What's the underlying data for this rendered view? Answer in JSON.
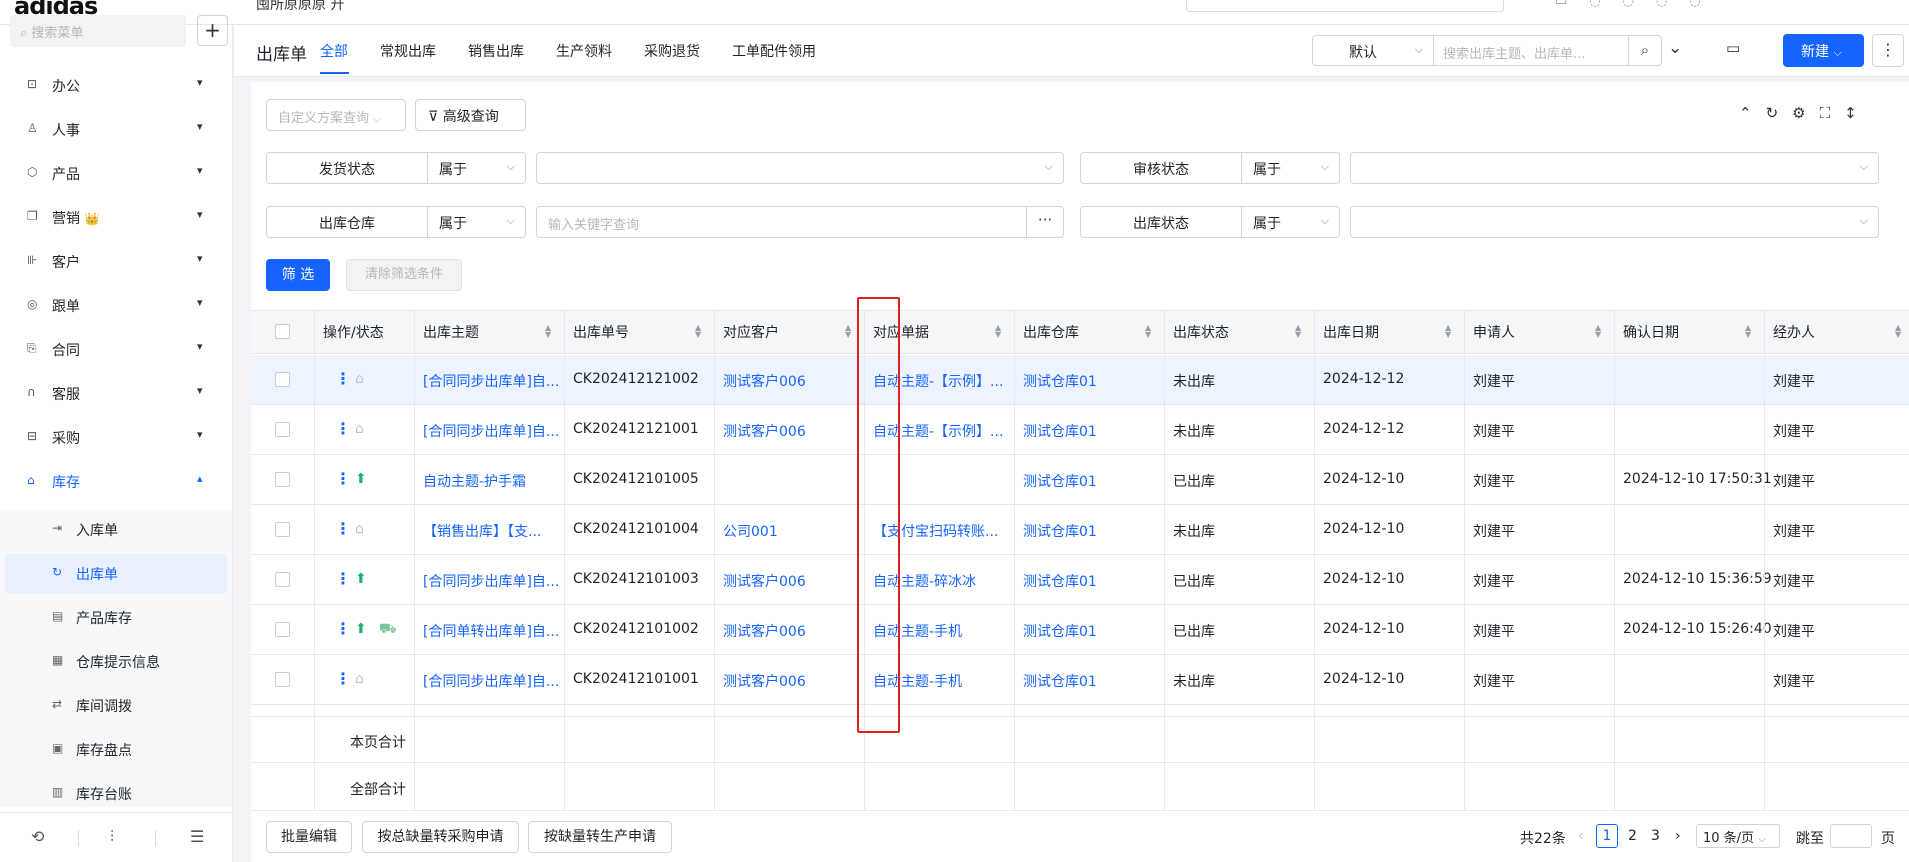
{
  "app": {
    "logo": "adidas",
    "top_crumb": "囤所原原原 升"
  },
  "sidebar": {
    "search_placeholder": "搜索菜单",
    "add_label": "+",
    "items": [
      {
        "label": "办公",
        "icon": "office-icon"
      },
      {
        "label": "人事",
        "icon": "hr-icon"
      },
      {
        "label": "产品",
        "icon": "product-icon"
      },
      {
        "label": "营销",
        "icon": "marketing-icon",
        "badge": "👑"
      },
      {
        "label": "客户",
        "icon": "customer-icon"
      },
      {
        "label": "跟单",
        "icon": "followup-icon"
      },
      {
        "label": "合同",
        "icon": "contract-icon"
      },
      {
        "label": "客服",
        "icon": "service-icon"
      },
      {
        "label": "采购",
        "icon": "purchase-icon"
      },
      {
        "label": "库存",
        "icon": "inventory-icon"
      }
    ],
    "sub_items": [
      {
        "label": "入库单"
      },
      {
        "label": "出库单"
      },
      {
        "label": "产品库存"
      },
      {
        "label": "仓库提示信息"
      },
      {
        "label": "库间调拨"
      },
      {
        "label": "库存盘点"
      },
      {
        "label": "库存台账"
      }
    ]
  },
  "header": {
    "title": "出库单",
    "tabs": [
      "全部",
      "常规出库",
      "销售出库",
      "生产领料",
      "采购退货",
      "工单配件领用"
    ],
    "view_select": "默认",
    "search_placeholder": "搜索出库主题、出库单...",
    "new_label": "新建"
  },
  "filters": {
    "scheme_placeholder": "自定义方案查询",
    "advanced_label": "高级查询",
    "rows": [
      {
        "field": "发货状态",
        "op": "属于"
      },
      {
        "field": "审核状态",
        "op": "属于"
      },
      {
        "field": "出库仓库",
        "op": "属于",
        "placeholder": "输入关键字查询"
      },
      {
        "field": "出库状态",
        "op": "属于"
      }
    ],
    "dots_label": "···",
    "filter_btn": "筛 选",
    "clear_btn": "清除筛选条件"
  },
  "table": {
    "columns": [
      "操作/状态",
      "出库主题",
      "出库单号",
      "对应客户",
      "对应单据",
      "出库仓库",
      "出库状态",
      "出库日期",
      "申请人",
      "确认日期",
      "经办人"
    ],
    "rows": [
      {
        "subject": "[合同同步出库单]自...",
        "no": "CK202412121002",
        "customer": "测试客户006",
        "doc": "自动主题-【示例】...",
        "warehouse": "测试仓库01",
        "status": "未出库",
        "date": "2024-12-12",
        "applicant": "刘建平",
        "confirm": "",
        "handler": "刘建平",
        "icons": [
          "grey"
        ]
      },
      {
        "subject": "[合同同步出库单]自...",
        "no": "CK202412121001",
        "customer": "测试客户006",
        "doc": "自动主题-【示例】...",
        "warehouse": "测试仓库01",
        "status": "未出库",
        "date": "2024-12-12",
        "applicant": "刘建平",
        "confirm": "",
        "handler": "刘建平",
        "icons": [
          "grey"
        ]
      },
      {
        "subject": "自动主题-护手霜",
        "no": "CK202412101005",
        "customer": "",
        "doc": "",
        "warehouse": "测试仓库01",
        "status": "已出库",
        "date": "2024-12-10",
        "applicant": "刘建平",
        "confirm": "2024-12-10 17:50:31",
        "handler": "刘建平",
        "icons": [
          "green"
        ]
      },
      {
        "subject": "【销售出库】【支...",
        "no": "CK202412101004",
        "customer": "公司001",
        "doc": "【支付宝扫码转账...",
        "warehouse": "测试仓库01",
        "status": "未出库",
        "date": "2024-12-10",
        "applicant": "刘建平",
        "confirm": "",
        "handler": "刘建平",
        "icons": [
          "grey"
        ]
      },
      {
        "subject": "[合同同步出库单]自...",
        "no": "CK202412101003",
        "customer": "测试客户006",
        "doc": "自动主题-碎冰冰",
        "warehouse": "测试仓库01",
        "status": "已出库",
        "date": "2024-12-10",
        "applicant": "刘建平",
        "confirm": "2024-12-10 15:36:59",
        "handler": "刘建平",
        "icons": [
          "green"
        ]
      },
      {
        "subject": "[合同单转出库单]自...",
        "no": "CK202412101002",
        "customer": "测试客户006",
        "doc": "自动主题-手机",
        "warehouse": "测试仓库01",
        "status": "已出库",
        "date": "2024-12-10",
        "applicant": "刘建平",
        "confirm": "2024-12-10 15:26:40",
        "handler": "刘建平",
        "icons": [
          "green",
          "truck"
        ]
      },
      {
        "subject": "[合同同步出库单]自...",
        "no": "CK202412101001",
        "customer": "测试客户006",
        "doc": "自动主题-手机",
        "warehouse": "测试仓库01",
        "status": "未出库",
        "date": "2024-12-10",
        "applicant": "刘建平",
        "confirm": "",
        "handler": "刘建平",
        "icons": [
          "grey"
        ]
      }
    ],
    "page_sum_label": "本页合计",
    "all_sum_label": "全部合计"
  },
  "footer": {
    "buttons": [
      "批量编辑",
      "按总缺量转采购申请",
      "按缺量转生产申请"
    ],
    "total": "共22条",
    "pages": [
      "1",
      "2",
      "3"
    ],
    "page_size": "10 条/页",
    "jump_label": "跳至",
    "page_suffix": "页"
  },
  "colors": {
    "accent": "#1664ff",
    "highlight": "#e0201e",
    "done": "#12b76a"
  }
}
